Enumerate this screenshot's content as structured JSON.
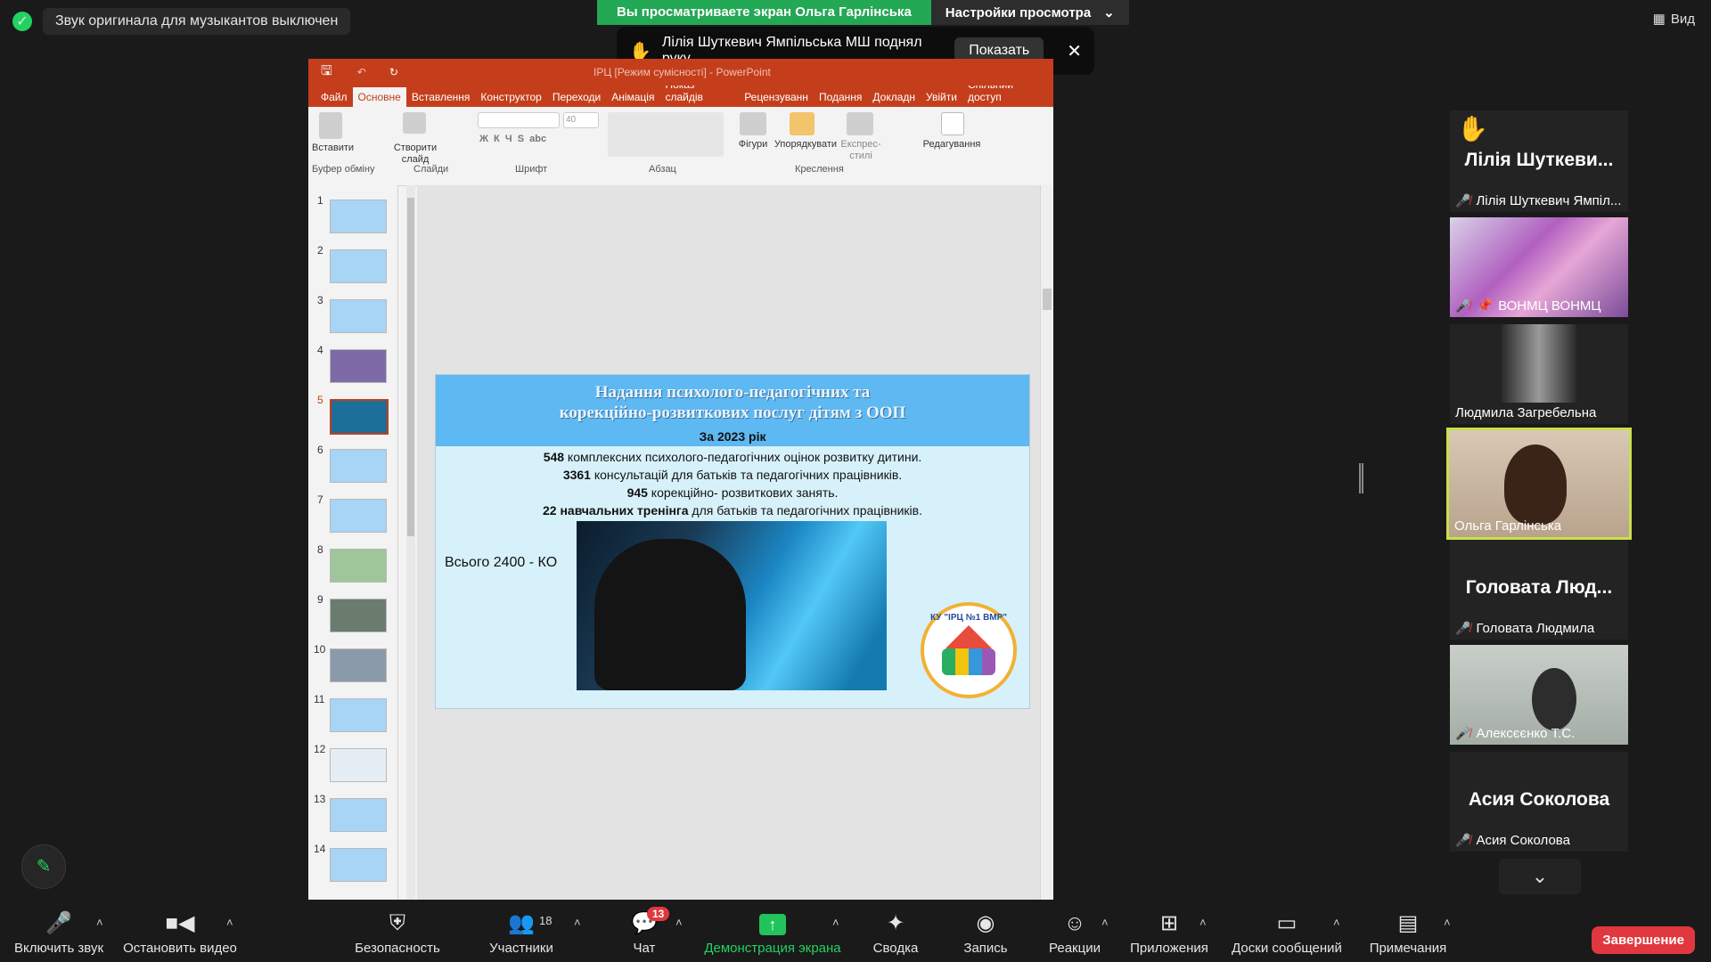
{
  "top": {
    "notice": "Звук оригинала для музыкантов выключен",
    "share_banner": "Вы просматриваете экран Ольга Гарлінська",
    "view_settings": "Настройки просмотра",
    "hand_message": "Лілія Шуткевич Ямпільська МШ поднял руку",
    "show_label": "Показать",
    "view_label": "Вид"
  },
  "ppt": {
    "title": "ІРЦ [Режим сумісності] - PowerPoint",
    "tabs": [
      "Файл",
      "Основне",
      "Вставлення",
      "Конструктор",
      "Переходи",
      "Анімація",
      "Показ слайдів",
      "Рецензуванн",
      "Подання",
      "Докладн",
      "Увійти",
      "Спільний доступ"
    ],
    "ribbon": {
      "paste": "Вставити",
      "new_slide": "Створити слайд",
      "shapes": "Фігури",
      "arrange": "Упорядкувати",
      "styles": "Експрес-стилі",
      "editing": "Редагування",
      "font_size": "40",
      "groups": [
        "Буфер обміну",
        "Слайди",
        "Шрифт",
        "Абзац",
        "Креслення"
      ]
    },
    "thumbs": [
      "1",
      "2",
      "3",
      "4",
      "5",
      "6",
      "7",
      "8",
      "9",
      "10",
      "11",
      "12",
      "13",
      "14"
    ],
    "slide": {
      "title_line1": "Надання психолого-педагогічних та",
      "title_line2": "корекційно-розвиткових послуг дітям з ООП",
      "year": "За 2023 рік",
      "line1_bold": "548",
      "line1_rest": " комплексних психолого-педагогічних оцінок розвитку дитини.",
      "line2_bold": "3361",
      "line2_rest": " консультацій для батьків та педагогічних працівників.",
      "line3_bold": "945",
      "line3_rest": " корекційно- розвиткових занять.",
      "line4_bold": "22 навчальних тренінга",
      "line4_rest": " для батьків та педагогічних працівників.",
      "total": "Всього 2400 - КО",
      "logo_text": "КУ \"ІРЦ №1 ВМР\""
    }
  },
  "participants": [
    {
      "big": "Лілія Шуткеви...",
      "name": "Лілія Шуткевич Ямпіл..."
    },
    {
      "name": "ВОНМЦ ВОНМЦ"
    },
    {
      "name": "Людмила Загребельна"
    },
    {
      "name": "Ольга Гарлінська"
    },
    {
      "big": "Головата Люд...",
      "name": "Головата Людмила"
    },
    {
      "name": "Алексєєнко Т.С."
    },
    {
      "big": "Асия Соколова",
      "name": "Асия Соколова"
    }
  ],
  "toolbar": {
    "unmute": "Включить звук",
    "stop_video": "Остановить видео",
    "security": "Безопасность",
    "participants": "Участники",
    "participants_count": "18",
    "chat": "Чат",
    "chat_badge": "13",
    "share": "Демонстрация экрана",
    "summary": "Сводка",
    "record": "Запись",
    "reactions": "Реакции",
    "apps": "Приложения",
    "whiteboards": "Доски сообщений",
    "notes": "Примечания",
    "end": "Завершение"
  }
}
